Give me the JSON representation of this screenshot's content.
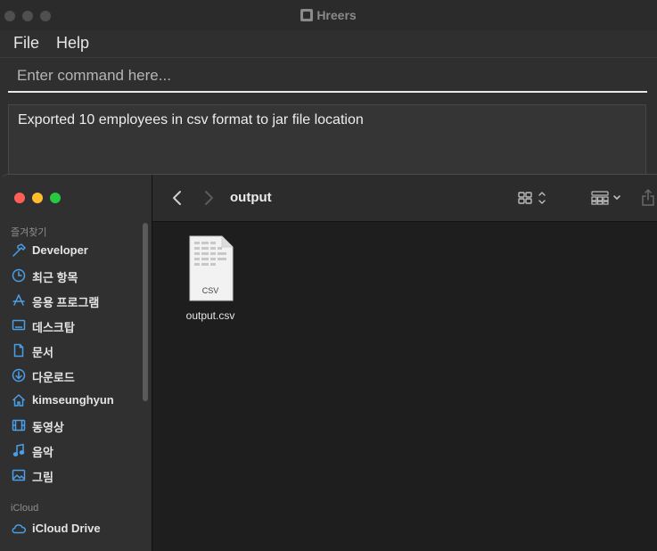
{
  "app": {
    "title": "Hreers",
    "menu": [
      "File",
      "Help"
    ],
    "command": {
      "placeholder": "Enter command here...",
      "value": ""
    },
    "result": "Exported 10 employees in csv format to jar file location"
  },
  "finder": {
    "folder": "output",
    "sidebar": {
      "favorites_label": "즐겨찾기",
      "items": [
        {
          "label": "Developer",
          "icon": "hammer-icon"
        },
        {
          "label": "최근 항목",
          "icon": "clock-icon"
        },
        {
          "label": "응용 프로그램",
          "icon": "applications-icon"
        },
        {
          "label": "데스크탑",
          "icon": "desktop-icon"
        },
        {
          "label": "문서",
          "icon": "document-icon"
        },
        {
          "label": "다운로드",
          "icon": "download-icon"
        },
        {
          "label": "kimseunghyun",
          "icon": "home-icon"
        },
        {
          "label": "동영상",
          "icon": "film-icon"
        },
        {
          "label": "음악",
          "icon": "music-note-icon"
        },
        {
          "label": "그림",
          "icon": "photo-icon"
        }
      ],
      "icloud_label": "iCloud",
      "icloud_items": [
        {
          "label": "iCloud Drive",
          "icon": "cloud-icon"
        }
      ]
    },
    "files": [
      {
        "name": "output.csv",
        "ext_label": "CSV"
      }
    ]
  },
  "colors": {
    "accent": "#4a9fe8",
    "close": "#ff5f57",
    "minimize": "#febc2e",
    "zoom": "#28c840"
  }
}
